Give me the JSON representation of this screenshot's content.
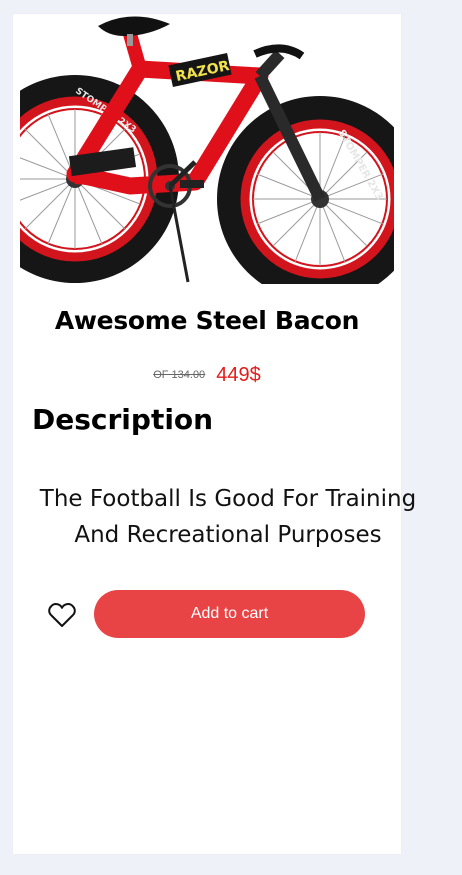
{
  "product": {
    "title": "Awesome Steel Bacon",
    "old_price": "OF 134.00",
    "new_price": "449$",
    "description_heading": "Description",
    "description": "The Football Is Good For Training And Recreational Purposes",
    "frame_text": "RAZOR",
    "tire_text": "STOMPER 2X3"
  },
  "actions": {
    "wishlist_icon": "heart-icon",
    "add_to_cart": "Add to cart"
  },
  "colors": {
    "accent": "#e84446",
    "price": "#e41b1b",
    "bike_frame": "#e0101b",
    "page_bg": "#eef1f8"
  }
}
